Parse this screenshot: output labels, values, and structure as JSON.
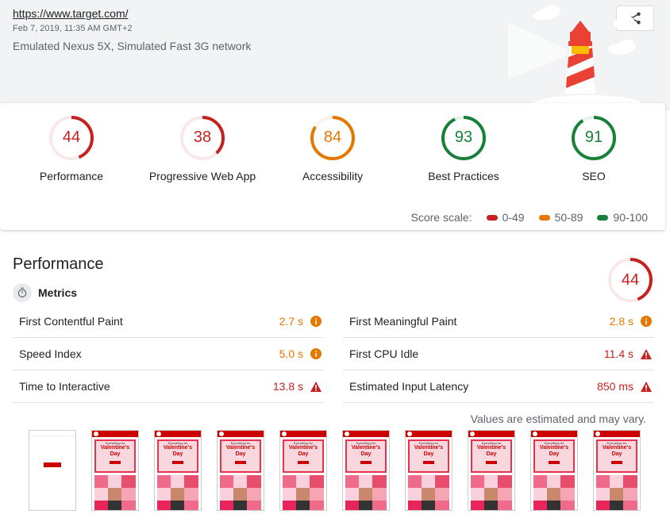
{
  "header": {
    "url": "https://www.target.com/",
    "date": "Feb 7, 2019, 11:35 AM GMT+2",
    "environment": "Emulated Nexus 5X, Simulated Fast 3G network",
    "share_icon": "share-icon"
  },
  "scores": [
    {
      "value": "44",
      "label": "Performance",
      "score": 0.44,
      "color": "#c5221f"
    },
    {
      "value": "38",
      "label": "Progressive Web App",
      "score": 0.38,
      "color": "#c5221f"
    },
    {
      "value": "84",
      "label": "Accessibility",
      "score": 0.84,
      "color": "#e67700"
    },
    {
      "value": "93",
      "label": "Best Practices",
      "score": 0.93,
      "color": "#188038"
    },
    {
      "value": "91",
      "label": "SEO",
      "score": 0.91,
      "color": "#188038"
    }
  ],
  "scale": {
    "label": "Score scale:",
    "ranges": [
      {
        "label": "0-49",
        "color": "#c5221f"
      },
      {
        "label": "50-89",
        "color": "#e67700"
      },
      {
        "label": "90-100",
        "color": "#188038"
      }
    ]
  },
  "performance": {
    "title": "Performance",
    "score": "44",
    "score_fraction": 0.44,
    "metrics_label": "Metrics",
    "metrics": [
      {
        "name": "First Contentful Paint",
        "value": "2.7 s",
        "status": "average"
      },
      {
        "name": "First Meaningful Paint",
        "value": "2.8 s",
        "status": "average"
      },
      {
        "name": "Speed Index",
        "value": "5.0 s",
        "status": "average"
      },
      {
        "name": "First CPU Idle",
        "value": "11.4 s",
        "status": "fail"
      },
      {
        "name": "Time to Interactive",
        "value": "13.8 s",
        "status": "fail"
      },
      {
        "name": "Estimated Input Latency",
        "value": "850 ms",
        "status": "fail"
      }
    ],
    "disclaimer": "Values are estimated and may vary.",
    "filmstrip": [
      {
        "frame": "blank"
      },
      {
        "frame": "valentine"
      },
      {
        "frame": "valentine"
      },
      {
        "frame": "valentine"
      },
      {
        "frame": "valentine"
      },
      {
        "frame": "valentine"
      },
      {
        "frame": "valentine"
      },
      {
        "frame": "valentine"
      },
      {
        "frame": "valentine"
      },
      {
        "frame": "valentine"
      }
    ],
    "filmstrip_text": {
      "small": "Everything for",
      "big": "Valentine's Day"
    }
  }
}
